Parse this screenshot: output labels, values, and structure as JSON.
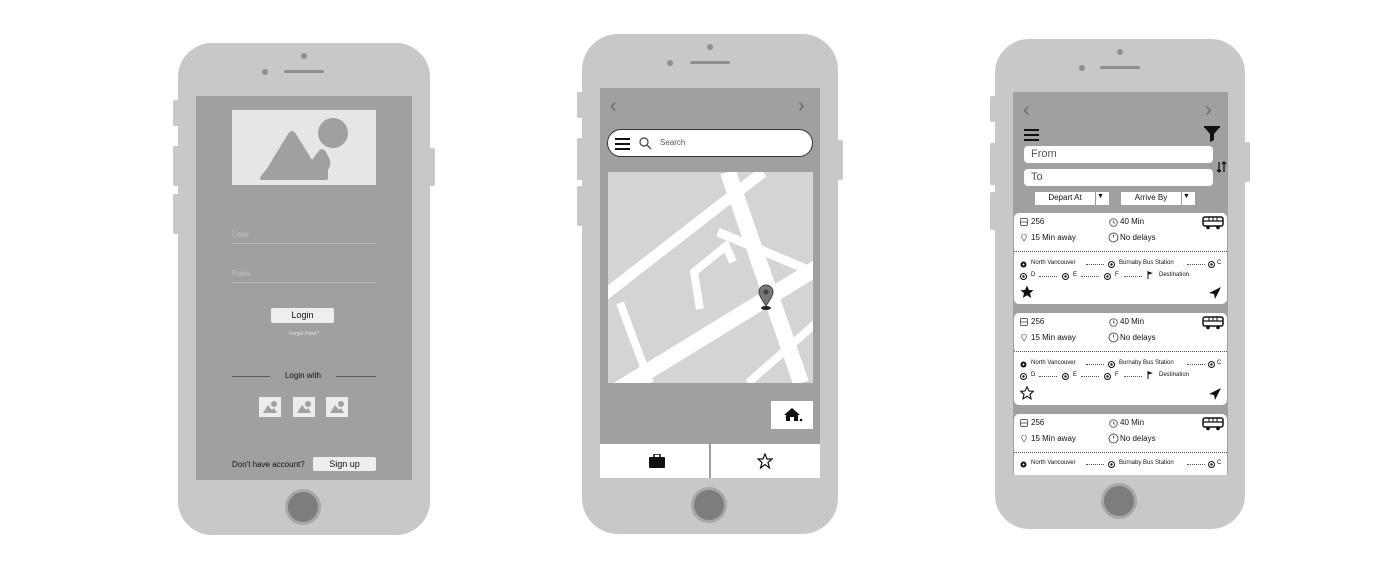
{
  "login": {
    "user_placeholder": "User",
    "pass_placeholder": "Pass",
    "login_label": "Login",
    "forgot_label": "Forgot Pass?",
    "login_with_label": "Login with",
    "no_account_label": "Don't have account?",
    "signup_label": "Sign up"
  },
  "map_screen": {
    "search_placeholder": "Search",
    "tabs": [
      "briefcase-icon",
      "star-outline-icon"
    ]
  },
  "routes": {
    "from_placeholder": "From",
    "to_placeholder": "To",
    "depart_label": "Depart At",
    "arrive_label": "Arrive By",
    "dropdown_arrow": "▼",
    "cards": [
      {
        "route": "256",
        "duration": "40 Min",
        "away": "15 Min away",
        "status": "No delays",
        "stop_origin": "North Vancouver",
        "stop_station": "Burnaby Bus Station",
        "stop_c": "C",
        "stop_d": "D",
        "stop_e": "E",
        "stop_f": "F",
        "stop_destination": "Destination",
        "favorite": true
      },
      {
        "route": "256",
        "duration": "40 Min",
        "away": "15 Min away",
        "status": "No delays",
        "stop_origin": "North Vancouver",
        "stop_station": "Burnaby Bus Station",
        "stop_c": "C",
        "stop_d": "D",
        "stop_e": "E",
        "stop_f": "F",
        "stop_destination": "Destination",
        "favorite": false
      },
      {
        "route": "256",
        "duration": "40 Min",
        "away": "15 Min away",
        "status": "No delays",
        "stop_origin": "North Vancouver",
        "stop_station": "Burnaby Bus Station",
        "stop_c": "C"
      }
    ]
  }
}
